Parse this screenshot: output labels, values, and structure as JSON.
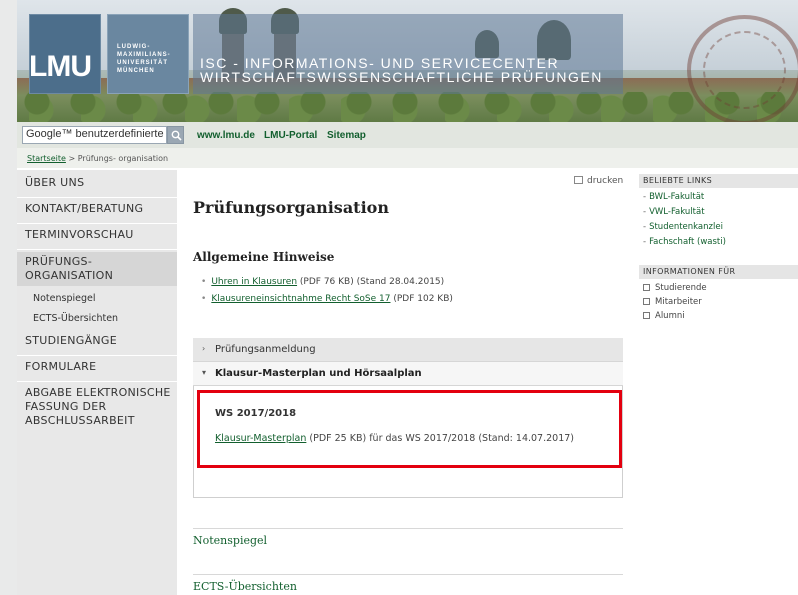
{
  "header": {
    "logo_text": "LMU",
    "university_lines": [
      "LUDWIG-",
      "MAXIMILIANS-",
      "UNIVERSITÄT",
      "MÜNCHEN"
    ],
    "title_line1": "ISC - INFORMATIONS- UND SERVICECENTER",
    "title_line2": "WIRTSCHAFTSWISSENSCHAFTLICHE PRÜFUNGEN"
  },
  "search": {
    "value": "Google™ benutzerdefinierte"
  },
  "top_links": [
    "www.lmu.de",
    "LMU-Portal",
    "Sitemap"
  ],
  "breadcrumb": {
    "home": "Startseite",
    "separator": " > ",
    "current": "Prüfungs- organisation"
  },
  "left_nav": {
    "items": [
      "ÜBER UNS",
      "KONTAKT/BERATUNG",
      "TERMINVORSCHAU",
      "PRÜFUNGS-",
      "ORGANISATION",
      "STUDIENGÄNGE",
      "FORMULARE",
      "ABGABE ELEKTRONISCHE",
      "FASSUNG DER",
      "ABSCHLUSSARBEIT"
    ],
    "sub_items": [
      "Notenspiegel",
      "ECTS-Übersichten"
    ]
  },
  "main": {
    "print_label": "drucken",
    "title": "Prüfungsorganisation",
    "section_title": "Allgemeine Hinweise",
    "hints": [
      {
        "link": "Uhren in Klausuren",
        "text": " (PDF 76 KB) (Stand 28.04.2015)"
      },
      {
        "link": "Klausureneinsichtnahme Recht SoSe 17",
        "text": " (PDF 102 KB)"
      }
    ],
    "accordion": {
      "item1": "Prüfungsanmeldung",
      "item2": "Klausur-Masterplan und Hörsaalplan",
      "item1_chevron": "›",
      "item2_chevron": "▾"
    },
    "ws": {
      "title": "WS 2017/2018",
      "link": "Klausur-Masterplan",
      "text": " (PDF 25 KB) für das WS 2017/2018 (Stand: 14.07.2017)"
    },
    "bottom_links": [
      "Notenspiegel",
      "ECTS-Übersichten"
    ]
  },
  "right": {
    "popular_header": "BELIEBTE LINKS",
    "popular_links": [
      "BWL-Fakultät",
      "VWL-Fakultät",
      "Studentenkanzlei",
      "Fachschaft (wasti)"
    ],
    "info_header": "INFORMATIONEN FÜR",
    "info_items": [
      "Studierende",
      "Mitarbeiter",
      "Alumni"
    ]
  },
  "colors": {
    "accent_green": "#125f2e",
    "highlight_red": "#e3000f",
    "header_blue": "#4c6e8b"
  }
}
